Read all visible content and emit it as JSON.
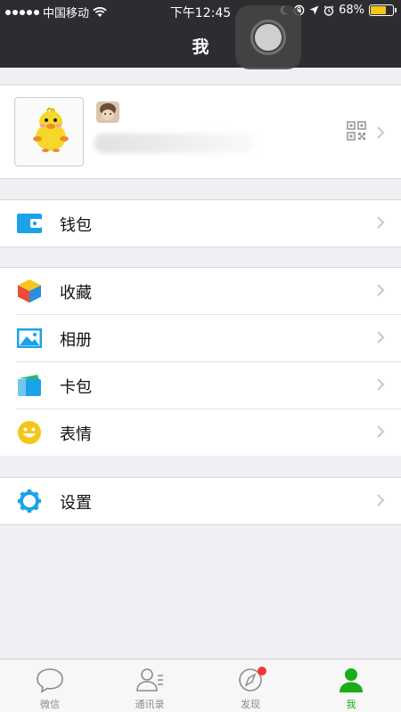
{
  "status_bar": {
    "carrier": "中国移动",
    "time": "下午12:45",
    "battery": "68%",
    "battery_level": 0.68,
    "icons": [
      "signal-dots-icon",
      "wifi-icon",
      "moon-icon",
      "rotation-lock-icon",
      "location-icon",
      "alarm-icon",
      "battery-icon"
    ]
  },
  "header": {
    "title": "我"
  },
  "profile": {
    "icons": [
      "avatar",
      "qr-code-icon",
      "chevron-right-icon"
    ]
  },
  "menu": {
    "wallet": {
      "label": "钱包",
      "icon": "wallet-icon"
    },
    "favorites": {
      "label": "收藏",
      "icon": "cube-icon"
    },
    "album": {
      "label": "相册",
      "icon": "photo-icon"
    },
    "cards": {
      "label": "卡包",
      "icon": "card-icon"
    },
    "stickers": {
      "label": "表情",
      "icon": "smiley-icon"
    },
    "settings": {
      "label": "设置",
      "icon": "gear-icon"
    }
  },
  "tabbar": {
    "tabs": [
      {
        "label": "微信",
        "icon": "chat-bubble-icon"
      },
      {
        "label": "通讯录",
        "icon": "contacts-icon"
      },
      {
        "label": "发现",
        "icon": "compass-icon"
      },
      {
        "label": "我",
        "icon": "person-icon",
        "active": true
      }
    ]
  },
  "colors": {
    "header_bg": "#2d2d31",
    "page_bg": "#efeff4",
    "active_green": "#1aad19",
    "badge_red": "#f43530",
    "icon_blue": "#1aa3e8"
  }
}
